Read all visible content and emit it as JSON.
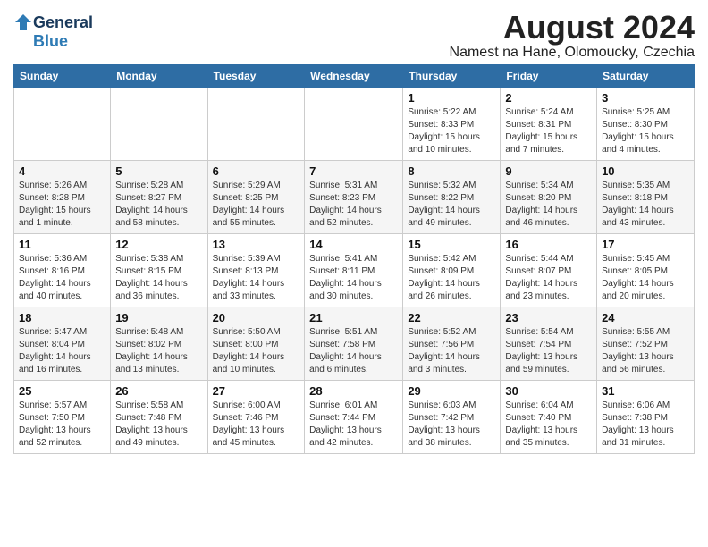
{
  "header": {
    "logo_general": "General",
    "logo_blue": "Blue",
    "month_year": "August 2024",
    "location": "Namest na Hane, Olomoucky, Czechia"
  },
  "calendar": {
    "weekdays": [
      "Sunday",
      "Monday",
      "Tuesday",
      "Wednesday",
      "Thursday",
      "Friday",
      "Saturday"
    ],
    "weeks": [
      [
        {
          "day": "",
          "info": ""
        },
        {
          "day": "",
          "info": ""
        },
        {
          "day": "",
          "info": ""
        },
        {
          "day": "",
          "info": ""
        },
        {
          "day": "1",
          "info": "Sunrise: 5:22 AM\nSunset: 8:33 PM\nDaylight: 15 hours\nand 10 minutes."
        },
        {
          "day": "2",
          "info": "Sunrise: 5:24 AM\nSunset: 8:31 PM\nDaylight: 15 hours\nand 7 minutes."
        },
        {
          "day": "3",
          "info": "Sunrise: 5:25 AM\nSunset: 8:30 PM\nDaylight: 15 hours\nand 4 minutes."
        }
      ],
      [
        {
          "day": "4",
          "info": "Sunrise: 5:26 AM\nSunset: 8:28 PM\nDaylight: 15 hours\nand 1 minute."
        },
        {
          "day": "5",
          "info": "Sunrise: 5:28 AM\nSunset: 8:27 PM\nDaylight: 14 hours\nand 58 minutes."
        },
        {
          "day": "6",
          "info": "Sunrise: 5:29 AM\nSunset: 8:25 PM\nDaylight: 14 hours\nand 55 minutes."
        },
        {
          "day": "7",
          "info": "Sunrise: 5:31 AM\nSunset: 8:23 PM\nDaylight: 14 hours\nand 52 minutes."
        },
        {
          "day": "8",
          "info": "Sunrise: 5:32 AM\nSunset: 8:22 PM\nDaylight: 14 hours\nand 49 minutes."
        },
        {
          "day": "9",
          "info": "Sunrise: 5:34 AM\nSunset: 8:20 PM\nDaylight: 14 hours\nand 46 minutes."
        },
        {
          "day": "10",
          "info": "Sunrise: 5:35 AM\nSunset: 8:18 PM\nDaylight: 14 hours\nand 43 minutes."
        }
      ],
      [
        {
          "day": "11",
          "info": "Sunrise: 5:36 AM\nSunset: 8:16 PM\nDaylight: 14 hours\nand 40 minutes."
        },
        {
          "day": "12",
          "info": "Sunrise: 5:38 AM\nSunset: 8:15 PM\nDaylight: 14 hours\nand 36 minutes."
        },
        {
          "day": "13",
          "info": "Sunrise: 5:39 AM\nSunset: 8:13 PM\nDaylight: 14 hours\nand 33 minutes."
        },
        {
          "day": "14",
          "info": "Sunrise: 5:41 AM\nSunset: 8:11 PM\nDaylight: 14 hours\nand 30 minutes."
        },
        {
          "day": "15",
          "info": "Sunrise: 5:42 AM\nSunset: 8:09 PM\nDaylight: 14 hours\nand 26 minutes."
        },
        {
          "day": "16",
          "info": "Sunrise: 5:44 AM\nSunset: 8:07 PM\nDaylight: 14 hours\nand 23 minutes."
        },
        {
          "day": "17",
          "info": "Sunrise: 5:45 AM\nSunset: 8:05 PM\nDaylight: 14 hours\nand 20 minutes."
        }
      ],
      [
        {
          "day": "18",
          "info": "Sunrise: 5:47 AM\nSunset: 8:04 PM\nDaylight: 14 hours\nand 16 minutes."
        },
        {
          "day": "19",
          "info": "Sunrise: 5:48 AM\nSunset: 8:02 PM\nDaylight: 14 hours\nand 13 minutes."
        },
        {
          "day": "20",
          "info": "Sunrise: 5:50 AM\nSunset: 8:00 PM\nDaylight: 14 hours\nand 10 minutes."
        },
        {
          "day": "21",
          "info": "Sunrise: 5:51 AM\nSunset: 7:58 PM\nDaylight: 14 hours\nand 6 minutes."
        },
        {
          "day": "22",
          "info": "Sunrise: 5:52 AM\nSunset: 7:56 PM\nDaylight: 14 hours\nand 3 minutes."
        },
        {
          "day": "23",
          "info": "Sunrise: 5:54 AM\nSunset: 7:54 PM\nDaylight: 13 hours\nand 59 minutes."
        },
        {
          "day": "24",
          "info": "Sunrise: 5:55 AM\nSunset: 7:52 PM\nDaylight: 13 hours\nand 56 minutes."
        }
      ],
      [
        {
          "day": "25",
          "info": "Sunrise: 5:57 AM\nSunset: 7:50 PM\nDaylight: 13 hours\nand 52 minutes."
        },
        {
          "day": "26",
          "info": "Sunrise: 5:58 AM\nSunset: 7:48 PM\nDaylight: 13 hours\nand 49 minutes."
        },
        {
          "day": "27",
          "info": "Sunrise: 6:00 AM\nSunset: 7:46 PM\nDaylight: 13 hours\nand 45 minutes."
        },
        {
          "day": "28",
          "info": "Sunrise: 6:01 AM\nSunset: 7:44 PM\nDaylight: 13 hours\nand 42 minutes."
        },
        {
          "day": "29",
          "info": "Sunrise: 6:03 AM\nSunset: 7:42 PM\nDaylight: 13 hours\nand 38 minutes."
        },
        {
          "day": "30",
          "info": "Sunrise: 6:04 AM\nSunset: 7:40 PM\nDaylight: 13 hours\nand 35 minutes."
        },
        {
          "day": "31",
          "info": "Sunrise: 6:06 AM\nSunset: 7:38 PM\nDaylight: 13 hours\nand 31 minutes."
        }
      ]
    ]
  }
}
